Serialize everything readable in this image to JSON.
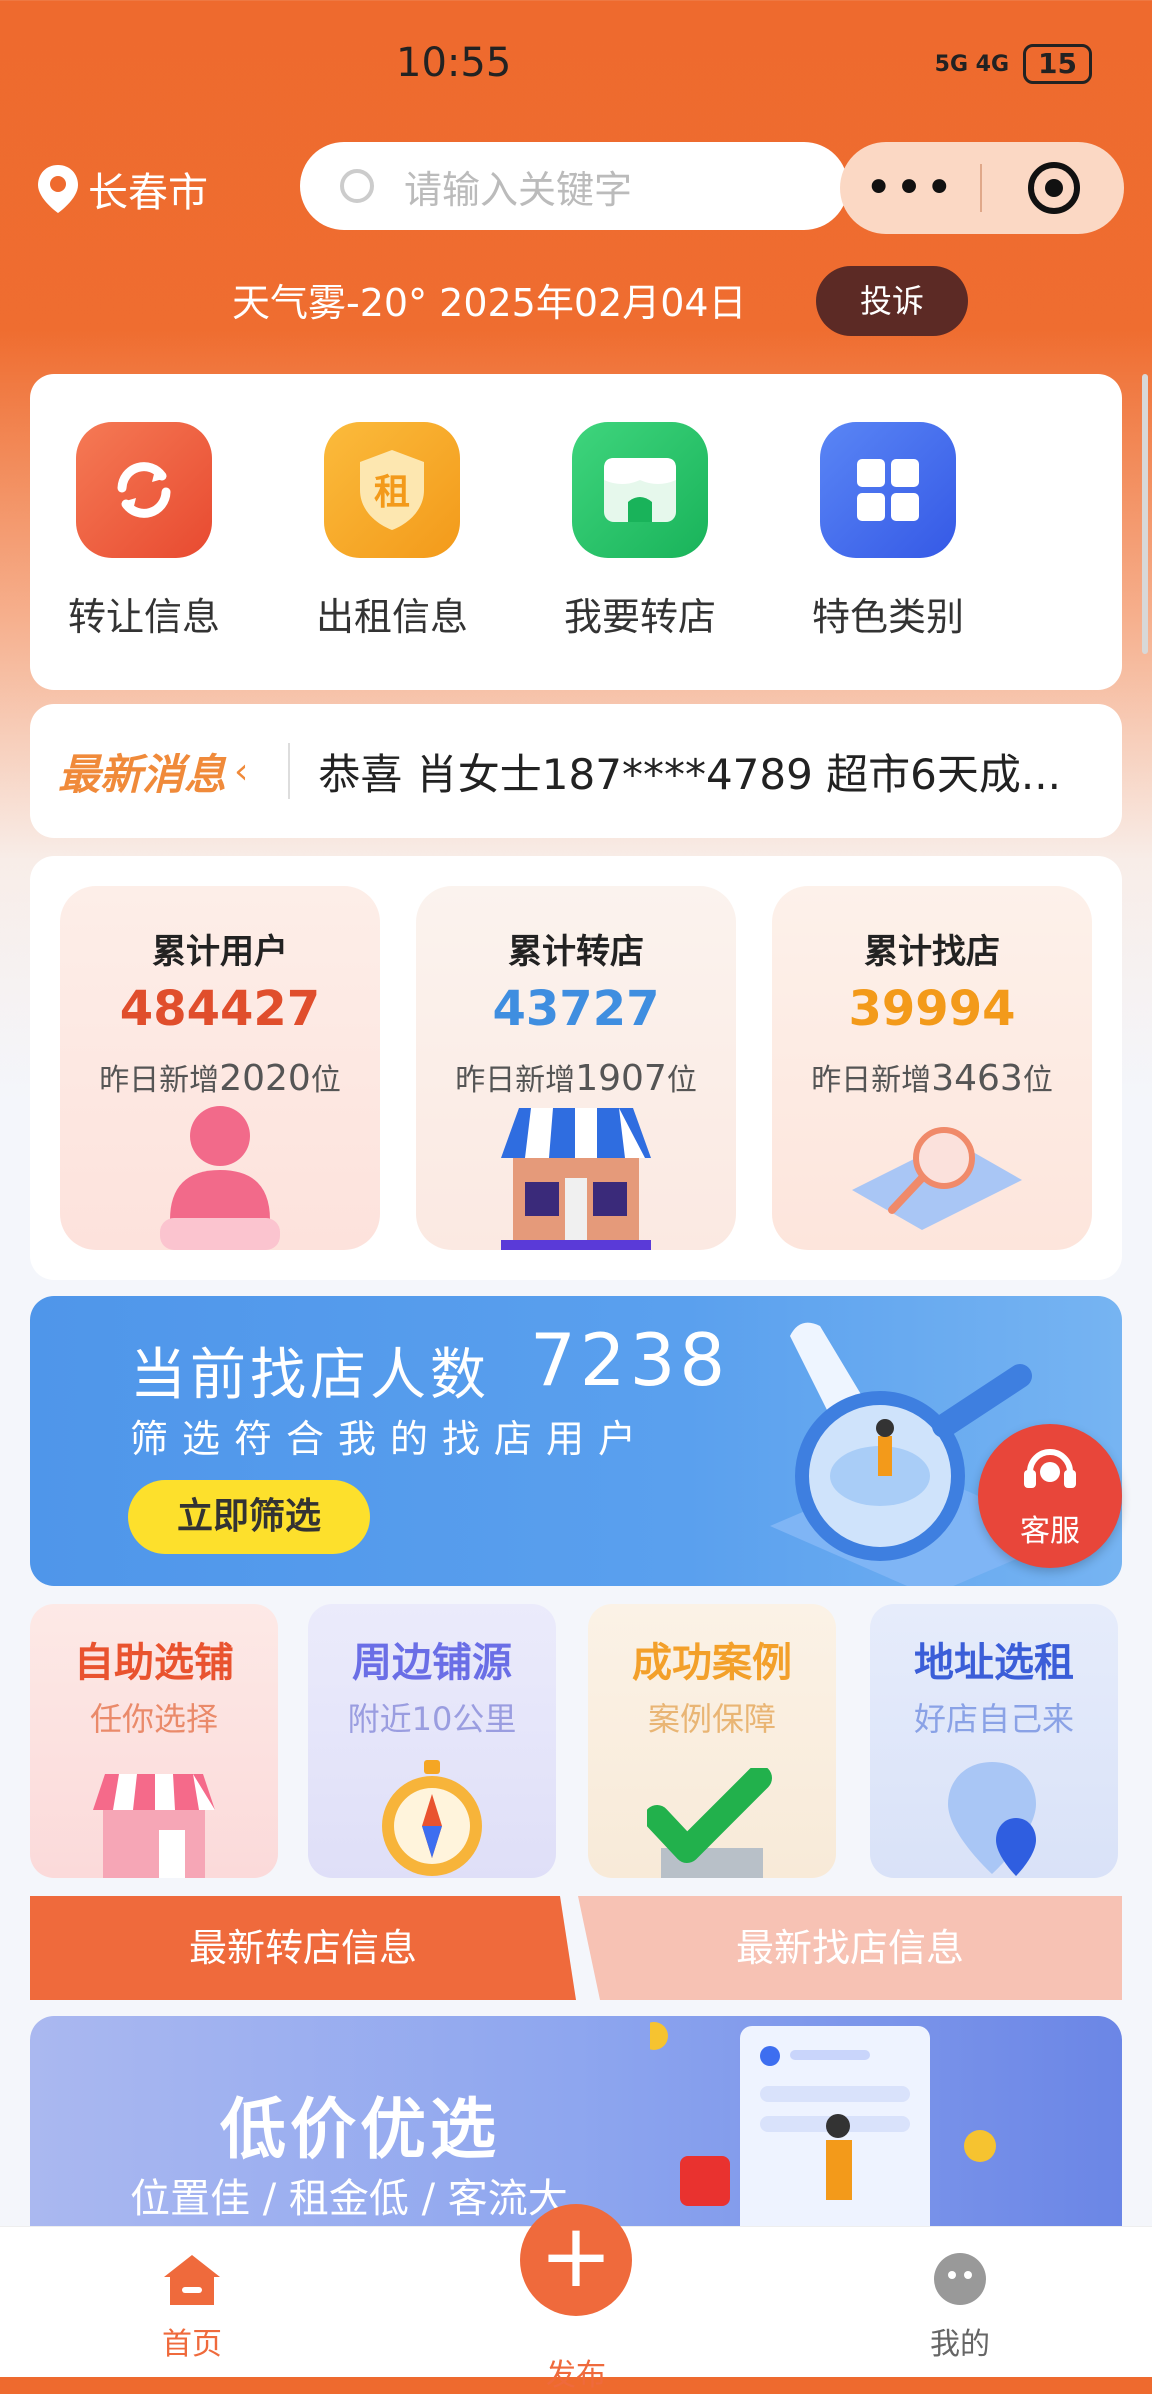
{
  "status_bar": {
    "time": "10:55",
    "network": "5G 4G",
    "battery": "15"
  },
  "header": {
    "city": "长春市",
    "search_placeholder": "请输入关键字",
    "weather_date": "天气雾-20° 2025年02月04日",
    "complain_label": "投诉"
  },
  "quick_menu": [
    {
      "label": "转让信息",
      "icon": "refresh-icon",
      "color": "#ec5a3c"
    },
    {
      "label": "出租信息",
      "icon": "rent-shield-icon",
      "glyph": "租",
      "color": "#f6a623"
    },
    {
      "label": "我要转店",
      "icon": "store-icon",
      "color": "#2cc46a"
    },
    {
      "label": "特色类别",
      "icon": "grid-icon",
      "color": "#3d6ef0"
    }
  ],
  "news": {
    "tag": "最新消息",
    "text": "恭喜 肖女士187****4789 超市6天成..."
  },
  "stats": [
    {
      "title": "累计用户",
      "value": "484427",
      "sub_prefix": "昨日新增",
      "sub_value": "2020",
      "sub_suffix": "位",
      "color": "#e04e2c"
    },
    {
      "title": "累计转店",
      "value": "43727",
      "sub_prefix": "昨日新增",
      "sub_value": "1907",
      "sub_suffix": "位",
      "color": "#3f8ee0"
    },
    {
      "title": "累计找店",
      "value": "39994",
      "sub_prefix": "昨日新增",
      "sub_value": "3463",
      "sub_suffix": "位",
      "color": "#f39a1a"
    }
  ],
  "banner": {
    "title": "当前找店人数",
    "count": "7238",
    "subtitle": "筛选符合我的找店用户",
    "button": "立即筛选"
  },
  "service_label": "客服",
  "features": [
    {
      "title": "自助选铺",
      "sub": "任你选择",
      "color": "#e9532f",
      "bg": "#fbe1e1"
    },
    {
      "title": "周边铺源",
      "sub": "附近10公里",
      "color": "#6a6ee6",
      "bg": "#e6e6fb"
    },
    {
      "title": "成功案例",
      "sub": "案例保障",
      "color": "#f3a02a",
      "bg": "#fbf0e2"
    },
    {
      "title": "地址选租",
      "sub": "好店自己来",
      "color": "#3b5ed8",
      "bg": "#e2e9fb"
    }
  ],
  "tabs": {
    "left": "最新转店信息",
    "right": "最新找店信息"
  },
  "promo": {
    "title": "低价优选",
    "subtitle": "位置佳 / 租金低 / 客流大"
  },
  "tabbar": {
    "home": "首页",
    "publish": "发布",
    "mine": "我的"
  }
}
